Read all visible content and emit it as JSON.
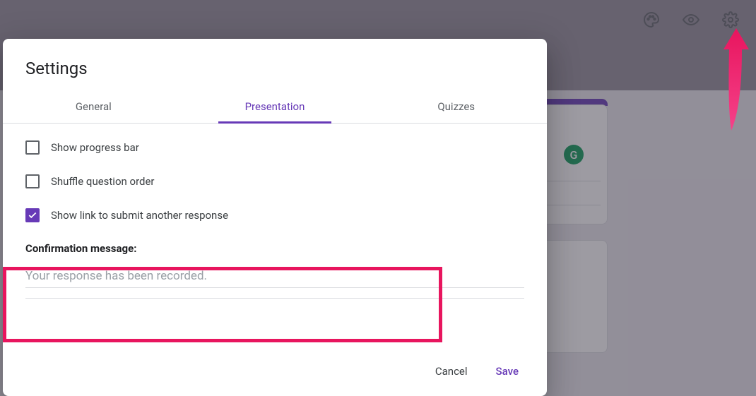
{
  "toolbar": {
    "palette_icon": "palette-icon",
    "preview_icon": "eye-icon",
    "settings_icon": "gear-icon"
  },
  "dialog": {
    "title": "Settings",
    "tabs": [
      {
        "label": "General",
        "active": false
      },
      {
        "label": "Presentation",
        "active": true
      },
      {
        "label": "Quizzes",
        "active": false
      }
    ],
    "options": [
      {
        "label": "Show progress bar",
        "checked": false
      },
      {
        "label": "Shuffle question order",
        "checked": false
      },
      {
        "label": "Show link to submit another response",
        "checked": true
      }
    ],
    "confirmation": {
      "label": "Confirmation message:",
      "placeholder": "Your response has been recorded.",
      "value": ""
    },
    "actions": {
      "cancel": "Cancel",
      "save": "Save"
    }
  },
  "background": {
    "grammarly_badge": "G"
  }
}
